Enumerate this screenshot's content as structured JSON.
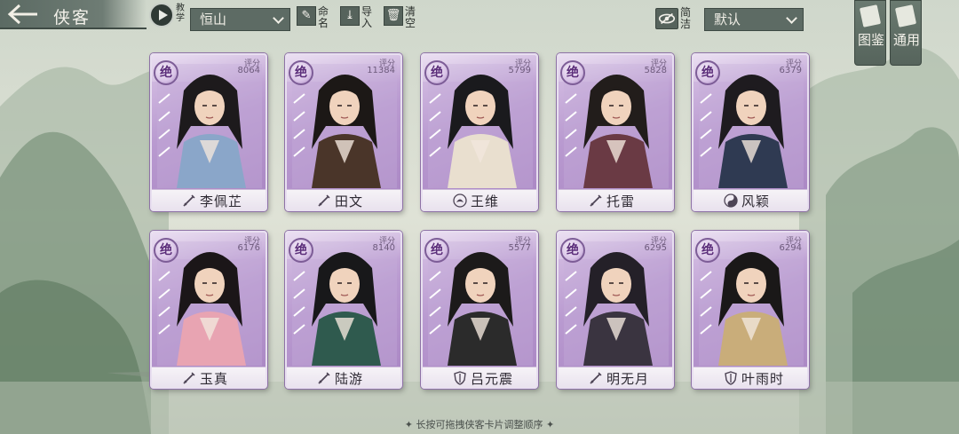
{
  "header": {
    "title": "侠客",
    "tutorial_label": "教学",
    "sect_select": "恒山",
    "rename_label": "命名",
    "import_label": "导入",
    "clear_label": "清空",
    "filter_label": "简洁",
    "sort_select": "默认"
  },
  "side_tabs": [
    {
      "label": "图鉴"
    },
    {
      "label": "通用"
    }
  ],
  "score_label": "评分",
  "rank_char": "绝",
  "cards": [
    {
      "name": "李佩芷",
      "score": "8064",
      "weapon_icon": "sword-icon"
    },
    {
      "name": "田文",
      "score": "11384",
      "weapon_icon": "sword-icon"
    },
    {
      "name": "王维",
      "score": "5799",
      "weapon_icon": "lotus-icon"
    },
    {
      "name": "托雷",
      "score": "5828",
      "weapon_icon": "sword-icon"
    },
    {
      "name": "风颖",
      "score": "6379",
      "weapon_icon": "taiji-icon"
    },
    {
      "name": "玉真",
      "score": "6176",
      "weapon_icon": "sword-icon"
    },
    {
      "name": "陆游",
      "score": "8140",
      "weapon_icon": "sword-icon"
    },
    {
      "name": "吕元震",
      "score": "5577",
      "weapon_icon": "shield-icon"
    },
    {
      "name": "明无月",
      "score": "6295",
      "weapon_icon": "sword-icon"
    },
    {
      "name": "叶雨时",
      "score": "6294",
      "weapon_icon": "shield-icon"
    }
  ],
  "hint": "✦ 长按可拖拽侠客卡片调整顺序 ✦"
}
